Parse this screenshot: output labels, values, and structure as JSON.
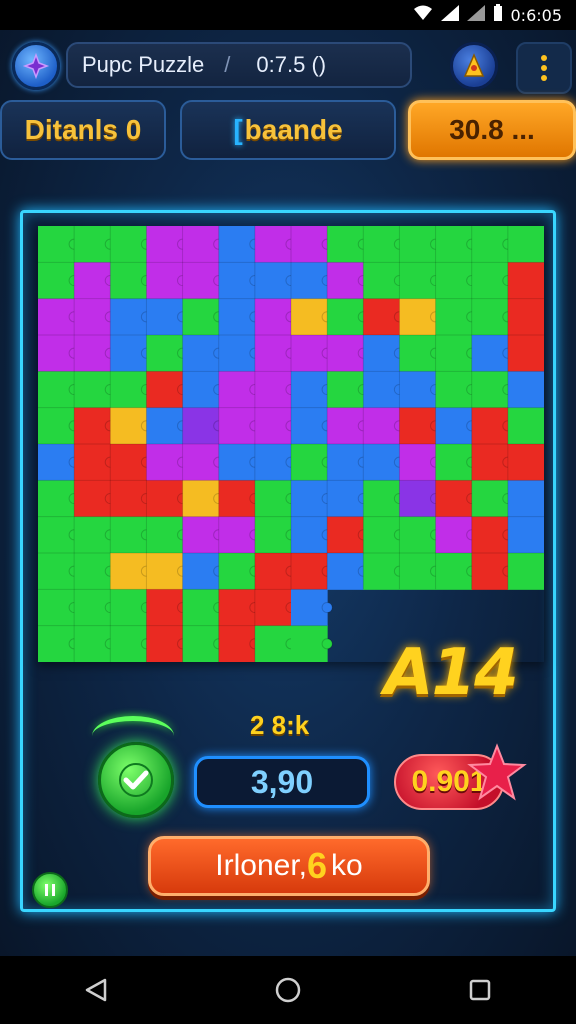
{
  "status_bar": {
    "time": "0:6:05",
    "icons": [
      "wifi-icon",
      "signal-icon",
      "signal-icon",
      "battery-icon"
    ]
  },
  "header": {
    "menu_icon": "star-burst-icon",
    "title": "Pupc Puzzle",
    "separator": "/",
    "timer": "0:7.5 ()",
    "trophy_icon": "trophy-icon",
    "more_icon": "more-vertical-icon"
  },
  "stats": {
    "left_label": "Ditanls 0",
    "mid_bracket": "[",
    "mid_label": "baande",
    "right_label": "30.8 ..."
  },
  "board": {
    "colors": {
      "green": "#25d640",
      "magenta": "#c12ee8",
      "blue": "#2b7df2",
      "red": "#ea2a22",
      "yellow": "#f5bc22",
      "purple": "#8a34e6"
    }
  },
  "hud": {
    "bonus_text": "A14",
    "moves_label": "2 8:k",
    "score": "3,90",
    "star_value": "0.901",
    "action_label": "Irloner,",
    "action_number": "6",
    "action_suffix": "ko"
  },
  "navbar": {
    "back_icon": "back-triangle-icon",
    "home_icon": "home-circle-icon",
    "recents_icon": "recents-square-icon"
  }
}
